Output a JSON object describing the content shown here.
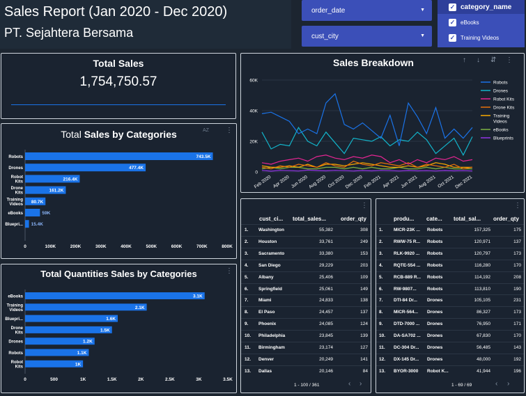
{
  "header": {
    "title": "Sales Report (Jan 2020 - Dec 2020)",
    "subtitle": "PT. Sejahtera Bersama"
  },
  "filters": {
    "order_date": "order_date",
    "cust_city": "cust_city"
  },
  "category_filter": {
    "header": "category_name",
    "items": [
      "eBooks",
      "Training Videos"
    ]
  },
  "total_sales": {
    "title": "Total Sales",
    "value": "1,754,750.57"
  },
  "sales_by_categories": {
    "title_pre": "Total ",
    "title_bold": "Sales by Categories",
    "chart_data": {
      "type": "bar",
      "orientation": "horizontal",
      "categories": [
        "Robots",
        "Drones",
        "Robot Kits",
        "Drone Kits",
        "Training Videos",
        "eBooks",
        "Blueprints"
      ],
      "category_lines": [
        [
          "Robots"
        ],
        [
          "Drones"
        ],
        [
          "Robot",
          "Kits"
        ],
        [
          "Drone",
          "Kits"
        ],
        [
          "Training",
          "Videos"
        ],
        [
          "eBooks"
        ],
        [
          "Bluepri..."
        ]
      ],
      "values": [
        743500,
        477400,
        216400,
        161200,
        80700,
        59000,
        15400
      ],
      "labels": [
        "743.5K",
        "477.4K",
        "216.4K",
        "161.2K",
        "80.7K",
        "59K",
        "15.4K"
      ],
      "xlim": [
        0,
        800000
      ],
      "ticks": [
        "0",
        "100K",
        "200K",
        "300K",
        "400K",
        "500K",
        "600K",
        "700K",
        "800K"
      ],
      "color": "#1a73e8"
    }
  },
  "qty_by_categories": {
    "title": "Total Quantities Sales by Categories",
    "chart_data": {
      "type": "bar",
      "orientation": "horizontal",
      "categories": [
        "eBooks",
        "Training Videos",
        "Blueprints",
        "Drone Kits",
        "Drones",
        "Robots",
        "Robot Kits"
      ],
      "category_lines": [
        [
          "eBooks"
        ],
        [
          "Training",
          "Videos"
        ],
        [
          "Bluepri..."
        ],
        [
          "Drone",
          "Kits"
        ],
        [
          "Drones"
        ],
        [
          "Robots"
        ],
        [
          "Robot",
          "Kits"
        ]
      ],
      "values": [
        3100,
        2100,
        1600,
        1500,
        1200,
        1100,
        1000
      ],
      "labels": [
        "3.1K",
        "2.1K",
        "1.6K",
        "1.5K",
        "1.2K",
        "1.1K",
        "1K"
      ],
      "xlim": [
        0,
        3500
      ],
      "ticks": [
        "0",
        "500",
        "1K",
        "1.5K",
        "2K",
        "2.5K",
        "3K",
        "3.5K"
      ],
      "color": "#1a73e8"
    }
  },
  "sales_breakdown": {
    "title": "Sales Breakdown",
    "chart_data": {
      "type": "line",
      "x": [
        "Jan 2020",
        "Feb 2020",
        "Mar 2020",
        "Apr 2020",
        "May 2020",
        "Jun 2020",
        "Jul 2020",
        "Aug 2020",
        "Sep 2020",
        "Oct 2020",
        "Nov 2020",
        "Dec 2020",
        "Jan 2021",
        "Feb 2021",
        "Mar 2021",
        "Apr 2021",
        "May 2021",
        "Jun 2021",
        "Jul 2021",
        "Aug 2021",
        "Sep 2021",
        "Oct 2021",
        "Nov 2021",
        "Dec 2021"
      ],
      "xticks": [
        "Feb 2020",
        "Apr 2020",
        "Jun 2020",
        "Aug 2020",
        "Oct 2020",
        "Dec 2020",
        "Feb 2021",
        "Apr 2021",
        "Jun 2021",
        "Aug 2021",
        "Oct 2021",
        "Dec 2021"
      ],
      "ylim": [
        0,
        60000
      ],
      "yticks": [
        "0",
        "20K",
        "40K",
        "60K"
      ],
      "legend_position": "right",
      "series": [
        {
          "name": "Robots",
          "color": "#1a73e8",
          "values": [
            38000,
            39000,
            36000,
            33000,
            25000,
            28000,
            25000,
            45000,
            51000,
            31000,
            28000,
            32000,
            27000,
            22000,
            37000,
            17000,
            45000,
            36000,
            25000,
            42000,
            22000,
            28000,
            22000,
            29000
          ]
        },
        {
          "name": "Drones",
          "color": "#12b5cb",
          "values": [
            26000,
            15000,
            18000,
            17000,
            29000,
            20000,
            17000,
            26000,
            19000,
            12000,
            22000,
            21000,
            20000,
            23000,
            17000,
            21000,
            20000,
            26000,
            21000,
            12000,
            17000,
            22000,
            11000,
            23000
          ]
        },
        {
          "name": "Robot Kits",
          "color": "#e52592",
          "values": [
            6000,
            5000,
            7000,
            8000,
            9000,
            7000,
            10000,
            11000,
            9000,
            8000,
            10000,
            9000,
            11000,
            10000,
            6000,
            8000,
            5000,
            8000,
            6000,
            9000,
            8000,
            10000,
            7000,
            8000
          ]
        },
        {
          "name": "Drone Kits",
          "color": "#e8710a",
          "values": [
            3000,
            2000,
            4000,
            3000,
            5000,
            4000,
            3000,
            6000,
            4000,
            3000,
            7000,
            5000,
            4000,
            6000,
            5000,
            4000,
            6000,
            3000,
            5000,
            4000,
            3000,
            5000,
            2000,
            3000
          ]
        },
        {
          "name": "Training Videos",
          "color": "#f9ab00",
          "values": [
            4000,
            3000,
            3000,
            4000,
            3000,
            5000,
            3000,
            5000,
            5000,
            4000,
            5000,
            6000,
            5000,
            4000,
            3000,
            3000,
            4000,
            3000,
            4000,
            6000,
            5000,
            3000,
            3000,
            3000
          ]
        },
        {
          "name": "eBooks",
          "color": "#7cb342",
          "values": [
            2000,
            3000,
            2000,
            3000,
            3000,
            2000,
            2000,
            3000,
            3000,
            2000,
            3000,
            2000,
            3000,
            2000,
            2000,
            3000,
            2000,
            2000,
            3000,
            2000,
            3000,
            2000,
            2000,
            2000
          ]
        },
        {
          "name": "Blueprints",
          "color": "#9334e6",
          "values": [
            1000,
            500,
            1000,
            800,
            600,
            1200,
            900,
            700,
            1000,
            800,
            600,
            900,
            700,
            1000,
            800,
            600,
            900,
            700,
            800,
            600,
            900,
            700,
            800,
            600
          ]
        }
      ]
    }
  },
  "city_table": {
    "headers": [
      "cust_ci...",
      "total_sales...",
      "order_qty"
    ],
    "rows": [
      [
        "1.",
        "Washington",
        "55,382",
        "308"
      ],
      [
        "2.",
        "Houston",
        "33,761",
        "249"
      ],
      [
        "3.",
        "Sacramento",
        "33,380",
        "153"
      ],
      [
        "4.",
        "San Diego",
        "29,229",
        "203"
      ],
      [
        "5.",
        "Albany",
        "25,406",
        "109"
      ],
      [
        "6.",
        "Springfield",
        "25,061",
        "149"
      ],
      [
        "7.",
        "Miami",
        "24,833",
        "138"
      ],
      [
        "8.",
        "El Paso",
        "24,457",
        "137"
      ],
      [
        "9.",
        "Phoenix",
        "24,085",
        "124"
      ],
      [
        "10.",
        "Philadelphia",
        "23,845",
        "139"
      ],
      [
        "11.",
        "Birmingham",
        "23,174",
        "127"
      ],
      [
        "12.",
        "Denver",
        "20,249",
        "141"
      ],
      [
        "13.",
        "Dallas",
        "20,146",
        "84"
      ]
    ],
    "pager": "1 - 100 / 361"
  },
  "product_table": {
    "headers": [
      "produ...",
      "cate...",
      "total_sal...",
      "order_qty"
    ],
    "rows": [
      [
        "1.",
        "MICR-23K ...",
        "Robots",
        "157,325",
        "175"
      ],
      [
        "2.",
        "RWW-75 R...",
        "Robots",
        "120,971",
        "137"
      ],
      [
        "3.",
        "RLK-9920 ...",
        "Robots",
        "120,797",
        "173"
      ],
      [
        "4.",
        "RQTE-554 ...",
        "Robots",
        "116,280",
        "170"
      ],
      [
        "5.",
        "RCB-889 R...",
        "Robots",
        "114,192",
        "208"
      ],
      [
        "6.",
        "RW-9807...",
        "Robots",
        "113,810",
        "190"
      ],
      [
        "7.",
        "DTI-84 Dr...",
        "Drones",
        "105,105",
        "231"
      ],
      [
        "8.",
        "MICR-564...",
        "Drones",
        "86,327",
        "173"
      ],
      [
        "9.",
        "DTD-7000 ...",
        "Drones",
        "76,950",
        "171"
      ],
      [
        "10.",
        "DA-SA702 ...",
        "Drones",
        "67,830",
        "170"
      ],
      [
        "11.",
        "DC-304 Dr...",
        "Drones",
        "56,485",
        "143"
      ],
      [
        "12.",
        "DX-145 Dr...",
        "Drones",
        "48,000",
        "192"
      ],
      [
        "13.",
        "BYOR-3000",
        "Robot K...",
        "41,944",
        "196"
      ]
    ],
    "pager": "1 - 69 / 69"
  }
}
